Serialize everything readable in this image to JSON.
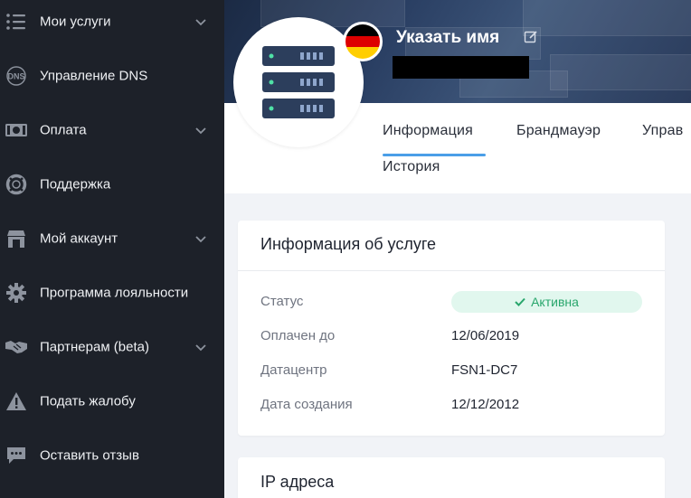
{
  "sidebar": {
    "items": [
      {
        "label": "Мои услуги",
        "icon": "list-icon",
        "has_chevron": true
      },
      {
        "label": "Управление DNS",
        "icon": "dns-icon",
        "has_chevron": false
      },
      {
        "label": "Оплата",
        "icon": "cash-icon",
        "has_chevron": true
      },
      {
        "label": "Поддержка",
        "icon": "lifebuoy-icon",
        "has_chevron": false
      },
      {
        "label": "Мой аккаунт",
        "icon": "store-icon",
        "has_chevron": true
      },
      {
        "label": "Программа лояльности",
        "icon": "gear-icon",
        "has_chevron": false
      },
      {
        "label": "Партнерам (beta)",
        "icon": "handshake-icon",
        "has_chevron": true
      },
      {
        "label": "Подать жалобу",
        "icon": "warning-icon",
        "has_chevron": false
      },
      {
        "label": "Оставить отзыв",
        "icon": "chat-icon",
        "has_chevron": false
      }
    ],
    "dns_icon_text": "DNS"
  },
  "header": {
    "server_name": "Указать имя",
    "flag_colors": [
      "#000000",
      "#dd0000",
      "#ffce00"
    ],
    "tabs": [
      "Информация",
      "Брандмауэр",
      "Управ",
      "История"
    ]
  },
  "info_card": {
    "title": "Информация об услуге",
    "rows": [
      {
        "label": "Статус",
        "value": "Активна"
      },
      {
        "label": "Оплачен до",
        "value": "12/06/2019"
      },
      {
        "label": "Датацентр",
        "value": "FSN1-DC7"
      },
      {
        "label": "Дата создания",
        "value": "12/12/2012"
      }
    ]
  },
  "ip_card": {
    "title": "IP адреса"
  },
  "colors": {
    "sidebar_bg": "#1d2129",
    "accent": "#4a9ee8",
    "status_green": "#28a66c",
    "status_bg": "#e1f7ee"
  }
}
